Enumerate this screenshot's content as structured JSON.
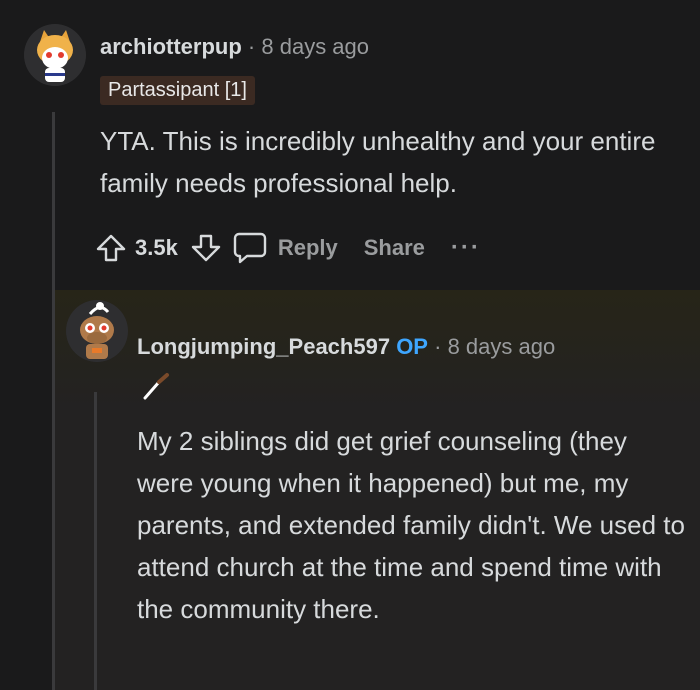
{
  "comment": {
    "username": "archiotterpup",
    "separator": "·",
    "time": "8 days ago",
    "flair": "Partassipant [1]",
    "body": "YTA. This is incredibly unhealthy and your entire family needs professional help.",
    "score": "3.5k",
    "reply_label": "Reply",
    "share_label": "Share",
    "more_label": "···"
  },
  "reply": {
    "username": "Longjumping_Peach597",
    "op_badge": "OP",
    "separator": "·",
    "time": "8 days ago",
    "body": "My 2 siblings did get grief counseling (they were young when it happened) but me, my parents, and extended family didn't. We used to attend church at the time and spend time with the community there."
  },
  "colors": {
    "background": "#1a1a1b",
    "op_accent": "#3ea6ff",
    "flair_bg": "#3b2a22"
  }
}
